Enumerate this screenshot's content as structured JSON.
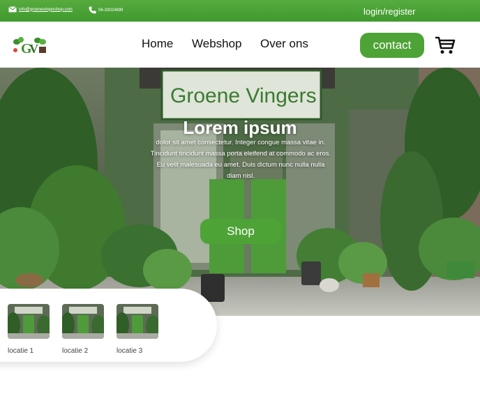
{
  "topbar": {
    "email": "info@groenevingershop.com",
    "phone": "06-33024899",
    "login": "login/register"
  },
  "header": {
    "nav": [
      "Home",
      "Webshop",
      "Over ons"
    ],
    "contact_label": "contact"
  },
  "hero": {
    "title": "Lorem ipsum",
    "text": "dolor sit amet consectetur. Integer congue massa vitae in. Tincidunt tincidunt massa porta eleifend at commodo ac eros. Eu velit malesuada eu amet. Duis dictum nunc nulla nulla diam nisl.",
    "shop_label": "Shop",
    "storefront_sign": "Groene Vingers"
  },
  "locations": [
    {
      "label": "locatie 1"
    },
    {
      "label": "locatie 2"
    },
    {
      "label": "locatie 3"
    }
  ],
  "colors": {
    "brand_green": "#4ea337",
    "topbar_green": "#4aa236"
  }
}
